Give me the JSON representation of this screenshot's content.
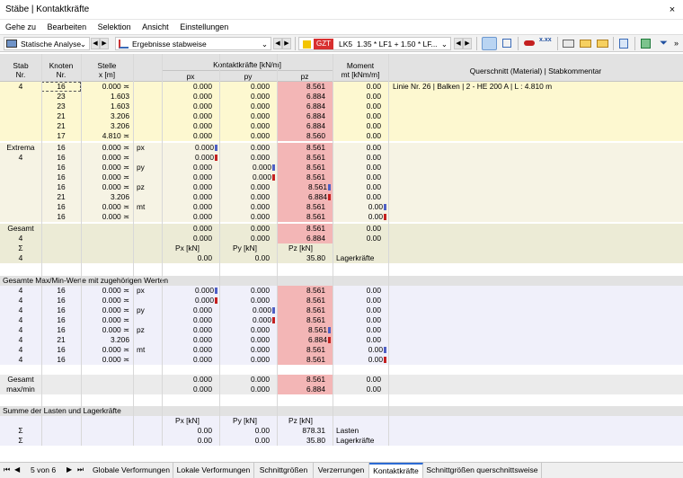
{
  "window": {
    "title": "Stäbe | Kontaktkräfte",
    "close": "×"
  },
  "menu": [
    "Gehe zu",
    "Bearbeiten",
    "Selektion",
    "Ansicht",
    "Einstellungen"
  ],
  "toolbar": {
    "analysis": "Statische Analyse",
    "results": "Ergebnisse stabweise",
    "lc_tag": "GZT",
    "lc_name": "LK5",
    "lc_combo": "1.35 * LF1 + 1.50 * LF..."
  },
  "header": {
    "stab": "Stab",
    "stab2": "Nr.",
    "knoten": "Knoten",
    "knoten2": "Nr.",
    "stelle": "Stelle",
    "stelle2": "x [m]",
    "kontakt": "Kontaktkräfte [kN/m]",
    "px": "px",
    "py": "py",
    "pz": "pz",
    "moment": "Moment",
    "moment2": "mt [kNm/m]",
    "qs": "Querschnitt (Material) | Stabkommentar"
  },
  "member_rows": [
    {
      "stab": "4",
      "knoten": "16",
      "x": "0.000 ≍",
      "px": "0.000",
      "py": "0.000",
      "pz": "8.561",
      "m": "0.00",
      "qs": "Linie Nr. 26 | Balken | 2 - HE 200 A | L : 4.810 m"
    },
    {
      "stab": "",
      "knoten": "23",
      "x": "1.603",
      "px": "0.000",
      "py": "0.000",
      "pz": "6.884",
      "m": "0.00",
      "qs": ""
    },
    {
      "stab": "",
      "knoten": "23",
      "x": "1.603",
      "px": "0.000",
      "py": "0.000",
      "pz": "6.884",
      "m": "0.00",
      "qs": ""
    },
    {
      "stab": "",
      "knoten": "21",
      "x": "3.206",
      "px": "0.000",
      "py": "0.000",
      "pz": "6.884",
      "m": "0.00",
      "qs": ""
    },
    {
      "stab": "",
      "knoten": "21",
      "x": "3.206",
      "px": "0.000",
      "py": "0.000",
      "pz": "6.884",
      "m": "0.00",
      "qs": ""
    },
    {
      "stab": "",
      "knoten": "17",
      "x": "4.810 ≍",
      "px": "0.000",
      "py": "0.000",
      "pz": "8.560",
      "m": "0.00",
      "qs": ""
    }
  ],
  "extrema_label": "Extrema",
  "extrema_stab": "4",
  "extrema_rows": [
    {
      "knoten": "16",
      "x": "0.000 ≍",
      "lbl": "px",
      "px": "0.000",
      "py": "0.000",
      "pz": "8.561",
      "m": "0.00",
      "mk": "px-max"
    },
    {
      "knoten": "16",
      "x": "0.000 ≍",
      "lbl": "",
      "px": "0.000",
      "py": "0.000",
      "pz": "8.561",
      "m": "0.00",
      "mk": "px-min"
    },
    {
      "knoten": "16",
      "x": "0.000 ≍",
      "lbl": "py",
      "px": "0.000",
      "py": "0.000",
      "pz": "8.561",
      "m": "0.00",
      "mk": "py-max"
    },
    {
      "knoten": "16",
      "x": "0.000 ≍",
      "lbl": "",
      "px": "0.000",
      "py": "0.000",
      "pz": "8.561",
      "m": "0.00",
      "mk": "py-min"
    },
    {
      "knoten": "16",
      "x": "0.000 ≍",
      "lbl": "pz",
      "px": "0.000",
      "py": "0.000",
      "pz": "8.561",
      "m": "0.00",
      "mk": "pz-max"
    },
    {
      "knoten": "21",
      "x": "3.206",
      "lbl": "",
      "px": "0.000",
      "py": "0.000",
      "pz": "6.884",
      "m": "0.00",
      "mk": "pz-min"
    },
    {
      "knoten": "16",
      "x": "0.000 ≍",
      "lbl": "mt",
      "px": "0.000",
      "py": "0.000",
      "pz": "8.561",
      "m": "0.00",
      "mk": "m-max"
    },
    {
      "knoten": "16",
      "x": "0.000 ≍",
      "lbl": "",
      "px": "0.000",
      "py": "0.000",
      "pz": "8.561",
      "m": "0.00",
      "mk": "m-min"
    }
  ],
  "gesamt": {
    "label": "Gesamt",
    "stab": "4",
    "r1": {
      "px": "0.000",
      "py": "0.000",
      "pz": "8.561",
      "m": "0.00"
    },
    "r2": {
      "px": "0.000",
      "py": "0.000",
      "pz": "6.884",
      "m": "0.00"
    },
    "sum_sym": "Σ",
    "sum_stab": "4",
    "hPx": "Px [kN]",
    "hPy": "Py [kN]",
    "hPz": "Pz [kN]",
    "Px": "0.00",
    "Py": "0.00",
    "Pz": "35.80",
    "lager": "Lagerkräfte"
  },
  "section2": {
    "title": "Gesamte Max/Min-Werte mit zugehörigen Werten",
    "rows": [
      {
        "stab": "4",
        "knoten": "16",
        "x": "0.000 ≍",
        "lbl": "px",
        "px": "0.000",
        "py": "0.000",
        "pz": "8.561",
        "m": "0.00",
        "mk": "px-max"
      },
      {
        "stab": "4",
        "knoten": "16",
        "x": "0.000 ≍",
        "lbl": "",
        "px": "0.000",
        "py": "0.000",
        "pz": "8.561",
        "m": "0.00",
        "mk": "px-min"
      },
      {
        "stab": "4",
        "knoten": "16",
        "x": "0.000 ≍",
        "lbl": "py",
        "px": "0.000",
        "py": "0.000",
        "pz": "8.561",
        "m": "0.00",
        "mk": "py-max"
      },
      {
        "stab": "4",
        "knoten": "16",
        "x": "0.000 ≍",
        "lbl": "",
        "px": "0.000",
        "py": "0.000",
        "pz": "8.561",
        "m": "0.00",
        "mk": "py-min"
      },
      {
        "stab": "4",
        "knoten": "16",
        "x": "0.000 ≍",
        "lbl": "pz",
        "px": "0.000",
        "py": "0.000",
        "pz": "8.561",
        "m": "0.00",
        "mk": "pz-max"
      },
      {
        "stab": "4",
        "knoten": "21",
        "x": "3.206",
        "lbl": "",
        "px": "0.000",
        "py": "0.000",
        "pz": "6.884",
        "m": "0.00",
        "mk": "pz-min"
      },
      {
        "stab": "4",
        "knoten": "16",
        "x": "0.000 ≍",
        "lbl": "mt",
        "px": "0.000",
        "py": "0.000",
        "pz": "8.561",
        "m": "0.00",
        "mk": "m-max"
      },
      {
        "stab": "4",
        "knoten": "16",
        "x": "0.000 ≍",
        "lbl": "",
        "px": "0.000",
        "py": "0.000",
        "pz": "8.561",
        "m": "0.00",
        "mk": "m-min"
      }
    ],
    "g_label": "Gesamt",
    "g_label2": "max/min",
    "g1": {
      "px": "0.000",
      "py": "0.000",
      "pz": "8.561",
      "m": "0.00"
    },
    "g2": {
      "px": "0.000",
      "py": "0.000",
      "pz": "6.884",
      "m": "0.00"
    }
  },
  "section3": {
    "title": "Summe der Lasten und Lagerkräfte",
    "hPx": "Px [kN]",
    "hPy": "Py [kN]",
    "hPz": "Pz [kN]",
    "rows": [
      {
        "sym": "Σ",
        "Px": "0.00",
        "Py": "0.00",
        "Pz": "878.31",
        "lbl": "Lasten"
      },
      {
        "sym": "Σ",
        "Px": "0.00",
        "Py": "0.00",
        "Pz": "35.80",
        "lbl": "Lagerkräfte"
      }
    ]
  },
  "statusbar": {
    "page": "5 von 6",
    "tabs": [
      "Globale Verformungen",
      "Lokale Verformungen",
      "Schnittgrößen",
      "Verzerrungen",
      "Kontaktkräfte",
      "Schnittgrößen querschnittsweise"
    ],
    "active": 4
  },
  "colors": {
    "pz_fill": "#f3b6b6",
    "yellow": "#fdf8d0",
    "extrema": "#f6f3e4",
    "gesamt": "#ecebd6",
    "lavender": "#f0f0fa",
    "accent": "#2d6bd4"
  }
}
